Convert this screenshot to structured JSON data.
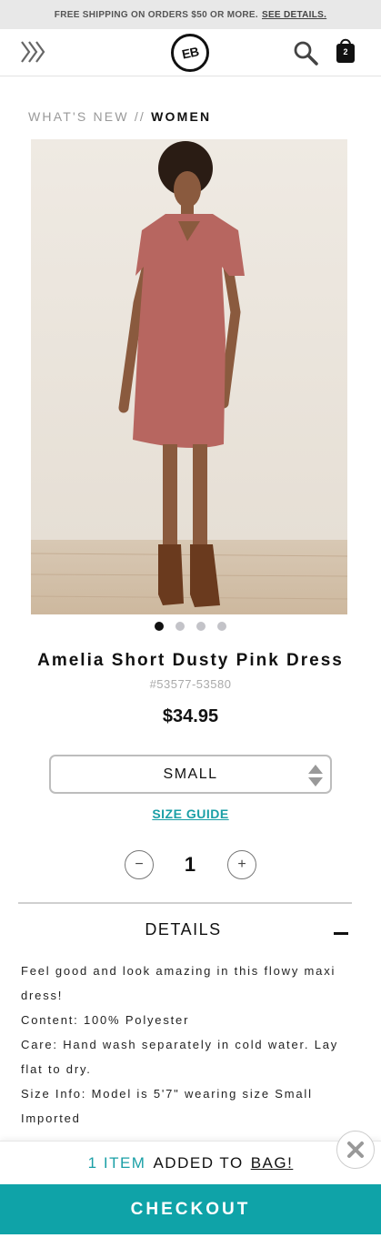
{
  "promo": {
    "text": "FREE SHIPPING ON ORDERS $50 OR MORE.",
    "link": "SEE DETAILS."
  },
  "header": {
    "logo_text": "EB",
    "bag_count": "2",
    "icons": [
      "menu-chevrons-icon",
      "search-icon",
      "shopping-bag-icon"
    ]
  },
  "breadcrumb": {
    "parent": "WHAT'S NEW",
    "separator": "//",
    "current": "WOMEN"
  },
  "product": {
    "title": "Amelia Short Dusty Pink Dress",
    "sku": "#53577-53580",
    "price": "$34.95",
    "image_count": 4,
    "active_image": 1
  },
  "size": {
    "selected": "SMALL",
    "guide_label": "SIZE GUIDE"
  },
  "quantity": {
    "value": "1",
    "minus": "−",
    "plus": "+"
  },
  "details": {
    "heading": "DETAILS",
    "line1": "Feel good and look amazing in this flowy maxi dress!",
    "line2": "Content: 100% Polyester",
    "line3": "Care: Hand wash separately in cold water. Lay flat to dry.",
    "line4": "Size Info:  Model is 5'7\" wearing size Small",
    "line5": "Imported"
  },
  "toast": {
    "count": "1 ITEM",
    "middle": "ADDED TO",
    "bag": "BAG!"
  },
  "checkout": {
    "label": "CHECKOUT"
  },
  "colors": {
    "accent": "#0fa3a8",
    "link": "#1a9fa6",
    "dress": "#b76660"
  }
}
